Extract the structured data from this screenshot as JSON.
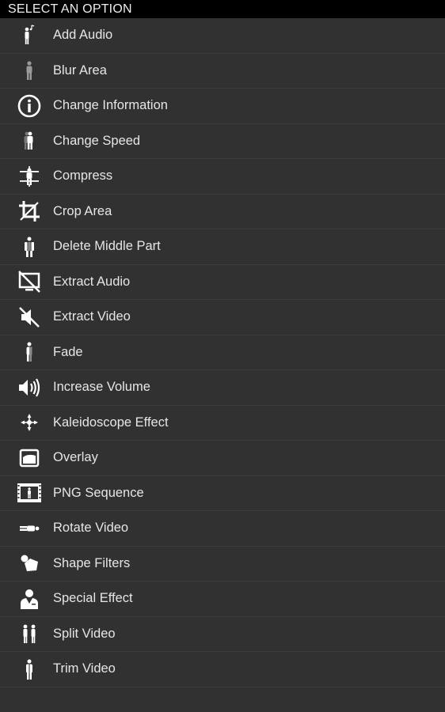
{
  "header": {
    "title": "SELECT AN OPTION"
  },
  "items": [
    {
      "label": "Add Audio",
      "icon": "person-music-icon"
    },
    {
      "label": "Blur Area",
      "icon": "blurred-person-icon"
    },
    {
      "label": "Change Information",
      "icon": "info-icon"
    },
    {
      "label": "Change Speed",
      "icon": "speed-person-icon"
    },
    {
      "label": "Compress",
      "icon": "compress-icon"
    },
    {
      "label": "Crop Area",
      "icon": "crop-icon"
    },
    {
      "label": "Delete Middle Part",
      "icon": "delete-middle-icon"
    },
    {
      "label": "Extract Audio",
      "icon": "no-video-icon"
    },
    {
      "label": "Extract Video",
      "icon": "mute-icon"
    },
    {
      "label": "Fade",
      "icon": "fade-person-icon"
    },
    {
      "label": "Increase Volume",
      "icon": "volume-up-icon"
    },
    {
      "label": "Kaleidoscope Effect",
      "icon": "kaleidoscope-icon"
    },
    {
      "label": "Overlay",
      "icon": "overlay-icon"
    },
    {
      "label": "PNG Sequence",
      "icon": "film-strip-icon"
    },
    {
      "label": "Rotate Video",
      "icon": "rotate-person-icon"
    },
    {
      "label": "Shape Filters",
      "icon": "shapes-icon"
    },
    {
      "label": "Special Effect",
      "icon": "special-person-icon"
    },
    {
      "label": "Split Video",
      "icon": "split-person-icon"
    },
    {
      "label": "Trim Video",
      "icon": "trim-person-icon"
    }
  ]
}
